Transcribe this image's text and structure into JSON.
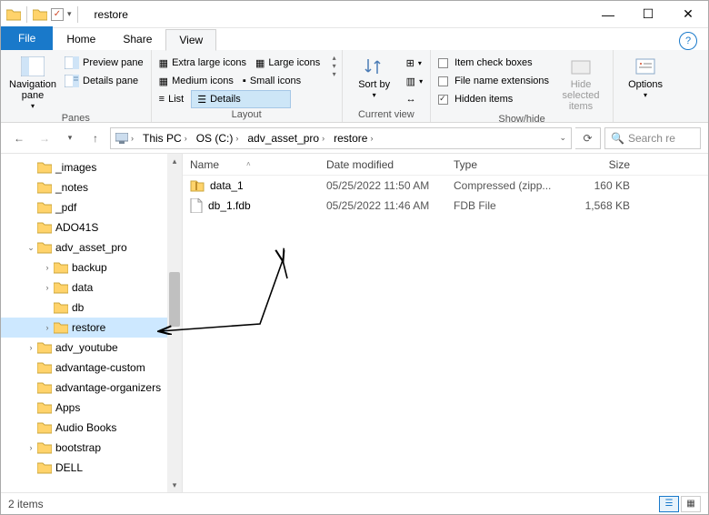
{
  "titlebar": {
    "title": "restore"
  },
  "tabs": {
    "file": "File",
    "home": "Home",
    "share": "Share",
    "view": "View"
  },
  "ribbon": {
    "panes": {
      "nav": "Navigation pane",
      "preview": "Preview pane",
      "details": "Details pane",
      "group": "Panes"
    },
    "layout": {
      "xl": "Extra large icons",
      "lg": "Large icons",
      "md": "Medium icons",
      "sm": "Small icons",
      "list": "List",
      "details": "Details",
      "group": "Layout"
    },
    "current": {
      "sort": "Sort by",
      "group": "Current view"
    },
    "showhide": {
      "chk": "Item check boxes",
      "ext": "File name extensions",
      "hidden": "Hidden items",
      "hidesel": "Hide selected items",
      "group": "Show/hide"
    },
    "options": "Options"
  },
  "breadcrumb": {
    "thispc": "This PC",
    "drive": "OS (C:)",
    "folder1": "adv_asset_pro",
    "folder2": "restore"
  },
  "search": {
    "placeholder": "Search re"
  },
  "columns": {
    "name": "Name",
    "date": "Date modified",
    "type": "Type",
    "size": "Size"
  },
  "files": [
    {
      "name": "data_1",
      "date": "05/25/2022 11:50 AM",
      "type": "Compressed (zipp...",
      "size": "160 KB",
      "icon": "zip"
    },
    {
      "name": "db_1.fdb",
      "date": "05/25/2022 11:46 AM",
      "type": "FDB File",
      "size": "1,568 KB",
      "icon": "file"
    }
  ],
  "tree": [
    {
      "label": "_images",
      "indent": 1,
      "tw": ""
    },
    {
      "label": "_notes",
      "indent": 1,
      "tw": ""
    },
    {
      "label": "_pdf",
      "indent": 1,
      "tw": ""
    },
    {
      "label": "ADO41S",
      "indent": 1,
      "tw": ""
    },
    {
      "label": "adv_asset_pro",
      "indent": 1,
      "tw": "v"
    },
    {
      "label": "backup",
      "indent": 2,
      "tw": ">"
    },
    {
      "label": "data",
      "indent": 2,
      "tw": ">"
    },
    {
      "label": "db",
      "indent": 2,
      "tw": ""
    },
    {
      "label": "restore",
      "indent": 2,
      "tw": ">",
      "selected": true
    },
    {
      "label": "adv_youtube",
      "indent": 1,
      "tw": ">"
    },
    {
      "label": "advantage-custom",
      "indent": 1,
      "tw": ""
    },
    {
      "label": "advantage-organizers",
      "indent": 1,
      "tw": ""
    },
    {
      "label": "Apps",
      "indent": 1,
      "tw": ""
    },
    {
      "label": "Audio Books",
      "indent": 1,
      "tw": ""
    },
    {
      "label": "bootstrap",
      "indent": 1,
      "tw": ">"
    },
    {
      "label": "DELL",
      "indent": 1,
      "tw": ""
    }
  ],
  "status": {
    "count": "2 items"
  }
}
